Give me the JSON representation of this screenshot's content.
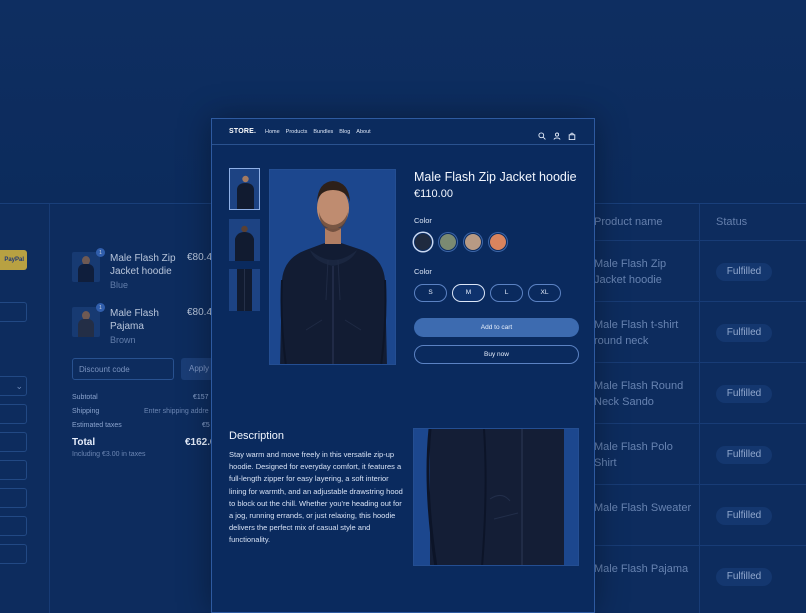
{
  "store": {
    "logo": "STORE.",
    "nav": [
      "Home",
      "Products",
      "Bundles",
      "Blog",
      "About"
    ]
  },
  "product": {
    "title": "Male Flash Zip Jacket hoodie",
    "price": "€110.00",
    "color_label": "Color",
    "colors": [
      "#1f2a3f",
      "#7b8a72",
      "#b89a84",
      "#d9845e"
    ],
    "selected_color_index": 0,
    "size_label": "Color",
    "sizes": [
      "S",
      "M",
      "L",
      "XL"
    ],
    "selected_size": "M",
    "add_to_cart": "Add to cart",
    "buy_now": "Buy now",
    "description_title": "Description",
    "description": "Stay warm and move freely in this versatile zip-up hoodie. Designed for everyday comfort, it features a full-length zipper for easy layering, a soft interior lining for warmth, and an adjustable drawstring hood to block out the chill. Whether you're heading out for a jog, running errands, or just relaxing, this hoodie delivers the perfect mix of casual style and functionality."
  },
  "checkout": {
    "paypal": "PayPal",
    "items": [
      {
        "name": "Male Flash Zip Jacket hoodie",
        "variant": "Blue",
        "price": "€80.4",
        "qty": "1"
      },
      {
        "name": "Male Flash Pajama",
        "variant": "Brown",
        "price": "€80.4",
        "qty": "1"
      }
    ],
    "discount_placeholder": "Discount code",
    "apply": "Apply",
    "subtotal_label": "Subtotal",
    "subtotal_value": "€157",
    "shipping_label": "Shipping",
    "shipping_value": "Enter shipping addre",
    "taxes_label": "Estimated taxes",
    "taxes_value": "€5",
    "total_label": "Total",
    "total_value": "€162.0",
    "total_note": "Including €3.00 in taxes"
  },
  "orders": {
    "col_product": "Product name",
    "col_status": "Status",
    "rows": [
      {
        "product": "Male Flash Zip Jacket hoodie",
        "status": "Fulfilled"
      },
      {
        "product": "Male Flash t-shirt round neck",
        "status": "Fulfilled"
      },
      {
        "product": "Male Flash Round Neck Sando",
        "status": "Fulfilled"
      },
      {
        "product": "Male Flash Polo Shirt",
        "status": "Fulfilled"
      },
      {
        "product": "Male Flash Sweater",
        "status": "Fulfilled"
      },
      {
        "product": "Male Flash Pajama",
        "status": "Fulfilled"
      }
    ]
  },
  "icons": [
    "search-icon",
    "user-icon",
    "bag-icon",
    "chevron-down-icon"
  ]
}
